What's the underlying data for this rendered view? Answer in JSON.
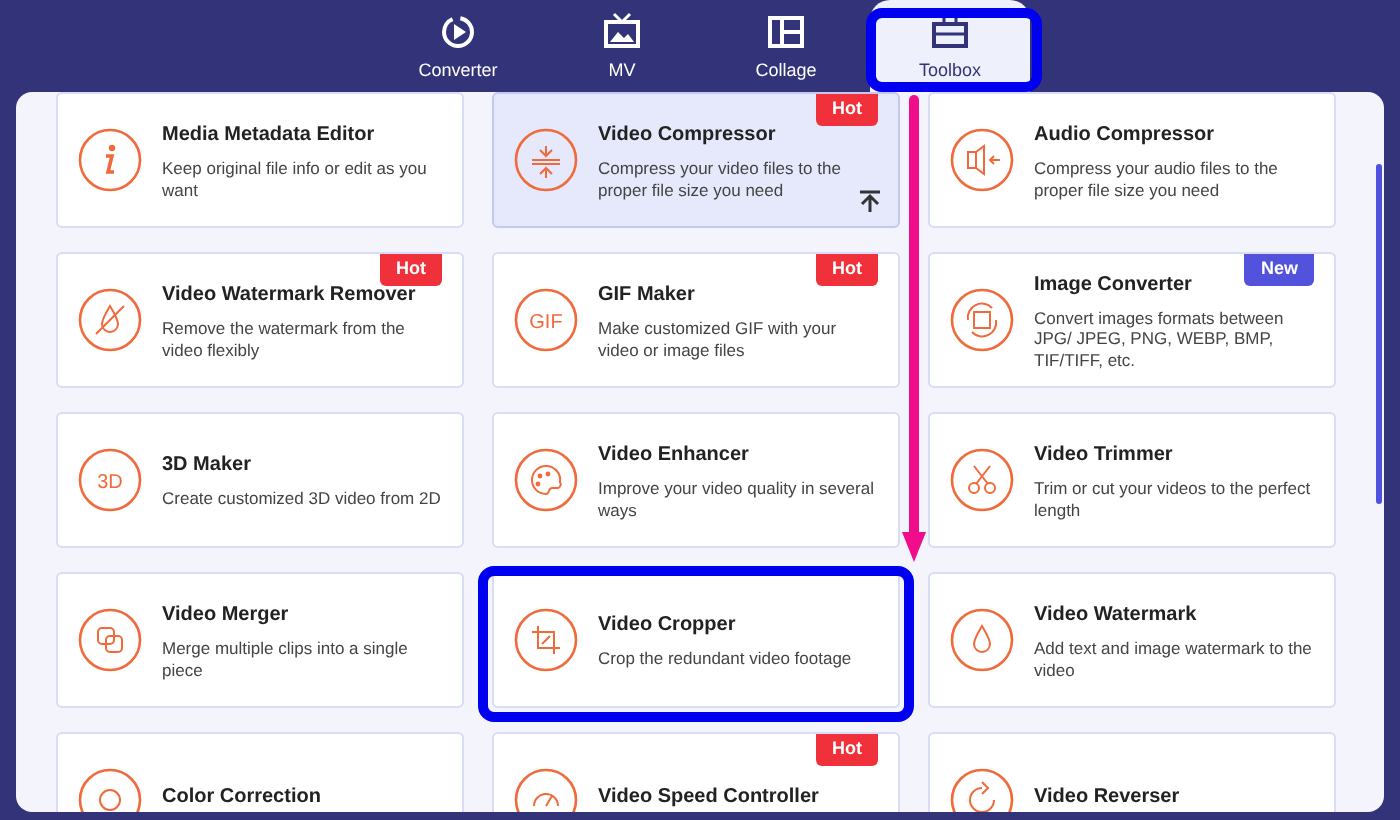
{
  "tabs": [
    {
      "label": "Converter",
      "selected": false
    },
    {
      "label": "MV",
      "selected": false
    },
    {
      "label": "Collage",
      "selected": false
    },
    {
      "label": "Toolbox",
      "selected": true
    }
  ],
  "tools": [
    {
      "title": "Media Metadata Editor",
      "description": "Keep original file info or edit as you want",
      "selected": false
    },
    {
      "title": "Video Compressor",
      "description": "Compress your video files to the proper file size you need",
      "badge": {
        "text": "Hot",
        "color": "#f0303a"
      },
      "selected": true
    },
    {
      "title": "Audio Compressor",
      "description": "Compress your audio files to the proper file size you need",
      "selected": false
    },
    {
      "title": "Video Watermark Remover",
      "description": "Remove the watermark from the video flexibly",
      "badge": {
        "text": "Hot",
        "color": "#f0303a"
      },
      "selected": false
    },
    {
      "title": "GIF Maker",
      "description": "Make customized GIF with your video or image files",
      "badge": {
        "text": "Hot",
        "color": "#f0303a"
      },
      "icon_text": "GIF",
      "selected": false
    },
    {
      "title": "Image Converter",
      "description": "Convert images formats between JPG/ JPEG, PNG, WEBP, BMP, TIF/TIFF, etc.",
      "badge": {
        "text": "New",
        "color": "#5252dc"
      },
      "selected": false
    },
    {
      "title": "3D Maker",
      "description": "Create customized 3D video from 2D",
      "icon_text": "3D",
      "selected": false
    },
    {
      "title": "Video Enhancer",
      "description": "Improve your video quality in several ways",
      "selected": false
    },
    {
      "title": "Video Trimmer",
      "description": "Trim or cut your videos to the perfect length",
      "selected": false
    },
    {
      "title": "Video Merger",
      "description": "Merge multiple clips into a single piece",
      "selected": false
    },
    {
      "title": "Video Cropper",
      "description": "Crop the redundant video footage",
      "selected": false
    },
    {
      "title": "Video Watermark",
      "description": "Add text and image watermark to the video",
      "selected": false
    },
    {
      "title": "Color Correction",
      "selected": false
    },
    {
      "title": "Video Speed Controller",
      "badge": {
        "text": "Hot",
        "color": "#f0303a"
      },
      "selected": false
    },
    {
      "title": "Video Reverser",
      "selected": false
    }
  ]
}
